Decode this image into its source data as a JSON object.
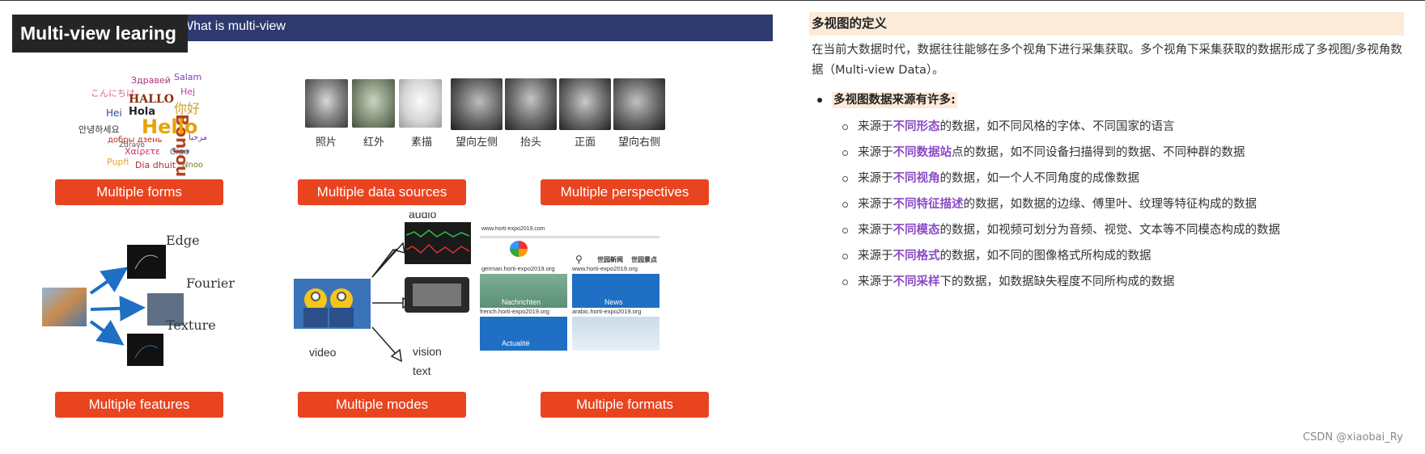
{
  "slide": {
    "title": "Multi-view learing",
    "banner": "What is multi-view",
    "buttons": {
      "forms": "Multiple forms",
      "data_sources": "Multiple data sources",
      "perspectives": "Multiple perspectives",
      "features": "Multiple features",
      "modes": "Multiple modes",
      "formats": "Multiple formats"
    },
    "word_cloud": [
      "Здравей",
      "Salam",
      "こんにちは",
      "Hej",
      "Bonjour",
      "HALLO",
      "你好",
      "Hola",
      "Hei",
      "Hello",
      "안녕하세요",
      "Zdravo",
      "добры дзень",
      "Χαίρετε",
      "Ciao",
      "Pupfi",
      "Dia dhuit",
      "Nnoo",
      "مرحبا"
    ],
    "face_labels": [
      "照片",
      "红外",
      "素描"
    ],
    "perspective_labels": [
      "望向左侧",
      "抬头",
      "正面",
      "望向右侧"
    ],
    "feature_labels": [
      "Edge",
      "Fourier",
      "Texture"
    ],
    "mode_labels": [
      "audio",
      "video",
      "vision",
      "text"
    ],
    "format_labels": {
      "top_url": "www.horti-expo2019.com",
      "german": "german.horti-expo2019.org",
      "www": "www.horti-expo2019.org",
      "french": "french.horti-expo2019.org",
      "arabic": "arabic.horti-expo2019.org",
      "nachrichten": "Nachrichten",
      "news": "News",
      "actualite": "Actualité",
      "nav1": "世园新闻",
      "nav2": "世园景点"
    }
  },
  "panel": {
    "heading": "多视图的定义",
    "paragraph": "在当前大数据时代，数据往往能够在多个视角下进行采集获取。多个视角下采集获取的数据形成了多视图/多视角数据（Multi-view Data）。",
    "bullet": "多视图数据来源有许多:",
    "items": [
      {
        "pre": "来源于",
        "hl": "不同形态",
        "post": "的数据，如不同风格的字体、不同国家的语言"
      },
      {
        "pre": "来源于",
        "hl": "不同数据站",
        "post": "点的数据，如不同设备扫描得到的数据、不同种群的数据"
      },
      {
        "pre": "来源于",
        "hl": "不同视角",
        "post": "的数据，如一个人不同角度的成像数据"
      },
      {
        "pre": "来源于",
        "hl": "不同特征描述",
        "post": "的数据，如数据的边缘、傅里叶、纹理等特征构成的数据"
      },
      {
        "pre": "来源于",
        "hl": "不同模态",
        "post": "的数据，如视频可划分为音频、视觉、文本等不同模态构成的数据"
      },
      {
        "pre": "来源于",
        "hl": "不同格式",
        "post": "的数据，如不同的图像格式所构成的数据"
      },
      {
        "pre": "来源于",
        "hl": "不同采样",
        "post": "下的数据，如数据缺失程度不同所构成的数据"
      }
    ]
  },
  "watermark": "CSDN @xiaobai_Ry"
}
